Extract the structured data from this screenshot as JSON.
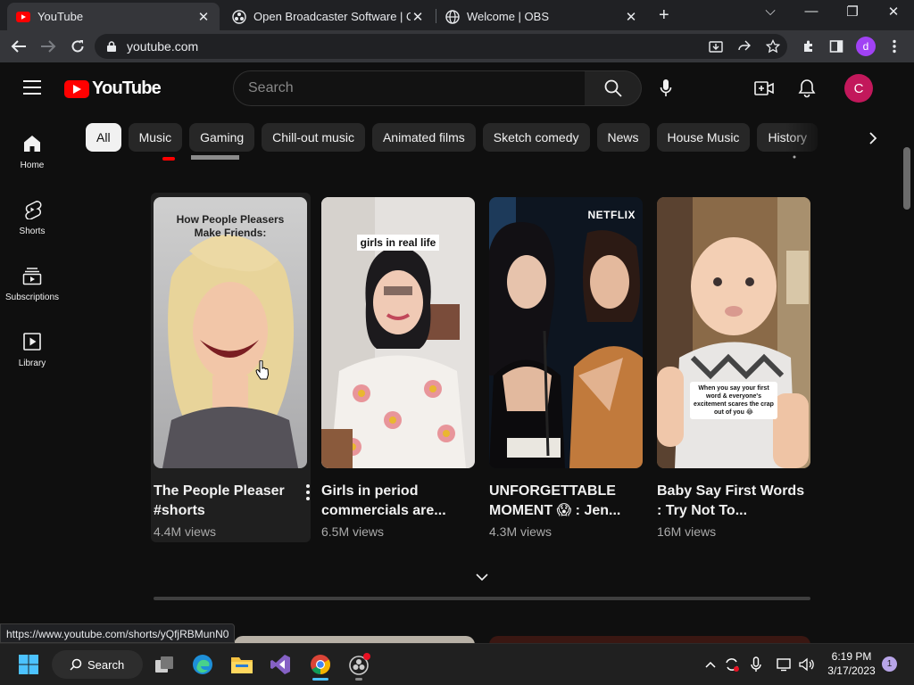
{
  "browser": {
    "tabs": [
      {
        "title": "YouTube",
        "favicon": "youtube-favicon",
        "active": true
      },
      {
        "title": "Open Broadcaster Software | OBS",
        "favicon": "obs-favicon",
        "active": false
      },
      {
        "title": "Welcome | OBS",
        "favicon": "globe-favicon",
        "active": false
      }
    ],
    "url": "youtube.com",
    "status_url": "https://www.youtube.com/shorts/yQfjRBMunN0",
    "profile_initial": "d"
  },
  "youtube": {
    "logo_text": "YouTube",
    "search_placeholder": "Search",
    "avatar_initial": "C",
    "chips": [
      "All",
      "Music",
      "Gaming",
      "Chill-out music",
      "Animated films",
      "Sketch comedy",
      "News",
      "House Music",
      "History"
    ],
    "sidebar": [
      {
        "label": "Home",
        "icon": "home-icon"
      },
      {
        "label": "Shorts",
        "icon": "shorts-icon"
      },
      {
        "label": "Subscriptions",
        "icon": "subscriptions-icon"
      },
      {
        "label": "Library",
        "icon": "library-icon"
      }
    ],
    "shorts": [
      {
        "title": "The People Pleaser #shorts",
        "views": "4.4M views",
        "overlay": "How People Pleasers Make Friends:"
      },
      {
        "title": "Girls in period commercials are...",
        "views": "6.5M views",
        "overlay": "girls in real life"
      },
      {
        "title": "UNFORGETTABLE MOMENT 😱 : Jen...",
        "views": "4.3M views",
        "overlay": "NETFLIX"
      },
      {
        "title": "Baby Say First Words : Try Not To...",
        "views": "16M views",
        "overlay": "When you say your first word & everyone's excitement scares the crap out of you 😂"
      }
    ]
  },
  "taskbar": {
    "search_label": "Search",
    "time": "6:19 PM",
    "date": "3/17/2023",
    "notification_count": "1"
  }
}
